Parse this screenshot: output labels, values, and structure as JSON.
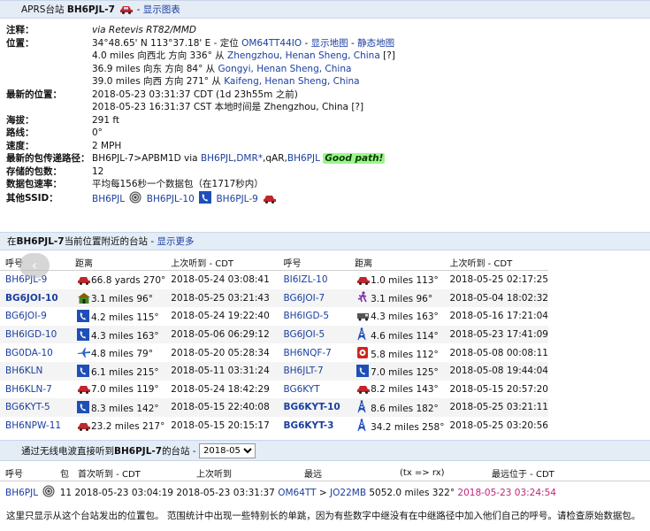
{
  "header": {
    "prefix": "APRS台站 ",
    "callsign": "BH6PJL-7",
    "sep": " - ",
    "show_chart": "显示图表"
  },
  "info": {
    "comment_label": "注释：",
    "comment_value": "via Retevis RT82/MMD",
    "position_label": "位置：",
    "pos_coords": "34°48.65' N 113°37.18' E - 定位 ",
    "pos_grid": "OM64TT44IO",
    "pos_sep1": " - ",
    "pos_map": "显示地图",
    "pos_sep2": " - ",
    "pos_static_map": "静态地图",
    "near1_text": "4.0 miles 向西北 方向 336° 从 ",
    "near1_place": "Zhengzhou, Henan Sheng, China",
    "near1_q": " [?]",
    "near2_text": "36.9 miles 向东 方向 84° 从 ",
    "near2_place": "Gongyi, Henan Sheng, China",
    "near3_text": "39.0 miles 向西 方向 271° 从 ",
    "near3_place": "Kaifeng, Henan Sheng, China",
    "latest_label": "最新的位置：",
    "latest_1": "2018-05-23 03:31:37 CDT (1d 23h55m 之前)",
    "latest_2": "2018-05-23 16:31:37 CST 本地时间是 Zhengzhou, China [?]",
    "alt_label": "海拔：",
    "alt_value": "291 ft",
    "course_label": "路线：",
    "course_value": "0°",
    "speed_label": "速度：",
    "speed_value": "2 MPH",
    "path_label": "最新的包传递路径：",
    "path_a": "BH6PJL-7>APBM1D via ",
    "path_b": "BH6PJL",
    "path_c": ",",
    "path_d": "DMR*",
    "path_e": ",qAR,",
    "path_f": "BH6PJL",
    "path_good": "Good path!",
    "stored_label": "存储的包数：",
    "stored_value": "12",
    "rate_label": "数据包速率：",
    "rate_value": "平均每156秒一个数据包（在1717秒内）",
    "ssid_label": "其他SSID：",
    "ssid_1": "BH6PJL",
    "ssid_2": "BH6PJL-10",
    "ssid_3": "BH6PJL-9"
  },
  "nearby_bar": {
    "prefix": "在",
    "callsign": "BH6PJL-7",
    "text": "当前位置附近的台站",
    "sep": " - ",
    "more": "显示更多"
  },
  "nearby_table": {
    "headers": [
      "呼号",
      "距离",
      "上次听到 - CDT",
      "呼号",
      "距离",
      "上次听到 - CDT"
    ],
    "rows": [
      {
        "c1": "BH6PJL-9",
        "d1": "66.8 yards 270°",
        "t1": "2018-05-24 03:08:41",
        "c2": "BI6IZL-10",
        "d2": "1.0 miles 113°",
        "t2": "2018-05-25 02:17:25"
      },
      {
        "c1": "BG6JOI-10",
        "d1": "3.1 miles 96°",
        "t1": "2018-05-25 03:21:43",
        "c2": "BG6JOI-7",
        "d2": "3.1 miles 96°",
        "t2": "2018-05-04 18:02:32"
      },
      {
        "c1": "BG6JOI-9",
        "d1": "4.2 miles 115°",
        "t1": "2018-05-24 19:22:40",
        "c2": "BH6IGD-5",
        "d2": "4.3 miles 163°",
        "t2": "2018-05-16 17:21:04"
      },
      {
        "c1": "BH6IGD-10",
        "d1": "4.3 miles 163°",
        "t1": "2018-05-06 06:29:12",
        "c2": "BG6JOI-5",
        "d2": "4.6 miles 114°",
        "t2": "2018-05-23 17:41:09"
      },
      {
        "c1": "BG0DA-10",
        "d1": "4.8 miles 79°",
        "t1": "2018-05-20 05:28:34",
        "c2": "BH6NQF-7",
        "d2": "5.8 miles 112°",
        "t2": "2018-05-08 00:08:11"
      },
      {
        "c1": "BH6KLN",
        "d1": "6.1 miles 215°",
        "t1": "2018-05-11 03:31:24",
        "c2": "BH6JLT-7",
        "d2": "7.0 miles 125°",
        "t2": "2018-05-08 19:44:04"
      },
      {
        "c1": "BH6KLN-7",
        "d1": "7.0 miles 119°",
        "t1": "2018-05-24 18:42:29",
        "c2": "BG6KYT",
        "d2": "8.2 miles 143°",
        "t2": "2018-05-15 20:57:20"
      },
      {
        "c1": "BG6KYT-5",
        "d1": "8.3 miles 142°",
        "t1": "2018-05-15 22:40:08",
        "c2": "BG6KYT-10",
        "d2": "8.6 miles 182°",
        "t2": "2018-05-25 03:21:11"
      },
      {
        "c1": "BH6NPW-11",
        "d1": "23.2 miles 217°",
        "t1": "2018-05-15 20:15:17",
        "c2": "BG6KYT-3",
        "d2": "34.2 miles 258°",
        "t2": "2018-05-25 03:20:56"
      }
    ]
  },
  "heard_bar": {
    "prefix": "通过无线电波直接听到",
    "callsign": "BH6PJL-7",
    "text": "的台站 - ",
    "month": "2018-05"
  },
  "heard_table": {
    "headers": [
      "呼号",
      "包",
      "首次听到 - CDT",
      "上次听到",
      "最远",
      "(tx => rx)",
      "最远位于 - CDT"
    ],
    "row": {
      "call": "BH6PJL",
      "packets": "11",
      "first": "2018-05-23 03:04:19",
      "last": "2018-05-23 03:31:37",
      "from": "OM64TT",
      "arrow": " > ",
      "to": "JO22MB",
      "dist": " 5052.0 miles 322°",
      "when": "2018-05-23 03:24:54"
    }
  },
  "footer": "这里只显示从这个台站发出的位置包。 范围统计中出现一些特别长的单跳，因为有些数字中继没有在中继路径中加入他们自己的呼号。请检查原始数据包。"
}
